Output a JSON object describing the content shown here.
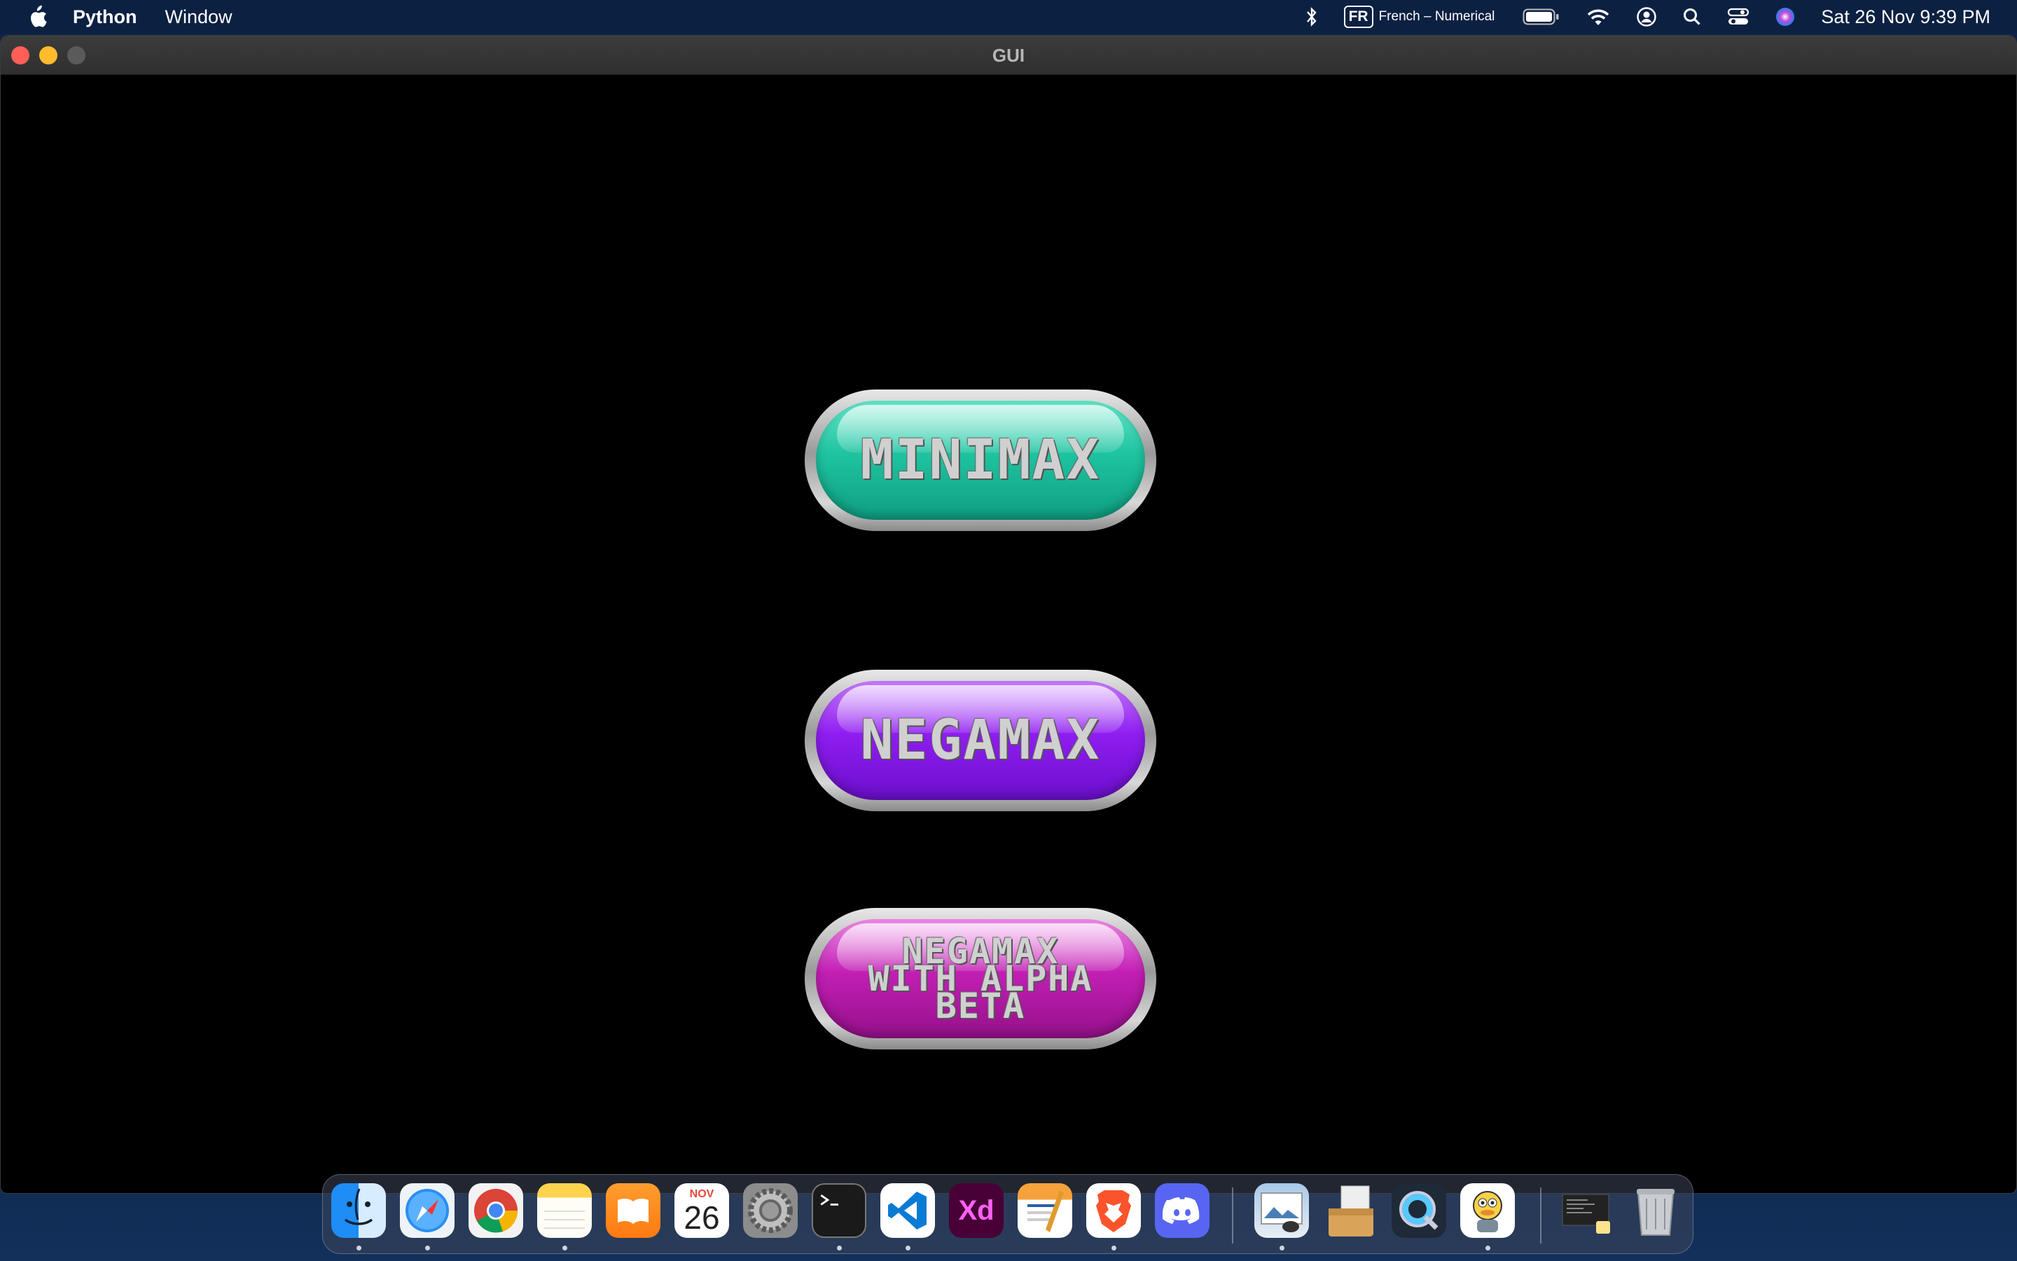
{
  "menubar": {
    "app_name": "Python",
    "menus": [
      "Window"
    ],
    "input_source_badge": "FR",
    "input_source_label": "French – Numerical",
    "datetime": "Sat 26 Nov  9:39 PM",
    "icons": [
      "apple-icon",
      "bluetooth-icon",
      "battery-icon",
      "wifi-icon",
      "user-icon",
      "search-icon",
      "control-center-icon",
      "siri-icon"
    ]
  },
  "window": {
    "title": "GUI"
  },
  "buttons": {
    "minimax": "MINIMAX",
    "negamax": "NEGAMAX",
    "alphabeta_lines": [
      "NEGAMAX",
      "WITH ALPHA",
      "BETA"
    ]
  },
  "dock": {
    "calendar_month": "NOV",
    "calendar_day": "26",
    "xd_label": "Xd",
    "apps": [
      "Finder",
      "Safari",
      "Chrome",
      "Notes",
      "Books",
      "Calendar",
      "System Preferences",
      "Terminal",
      "Visual Studio Code",
      "Adobe XD",
      "Pages",
      "Brave",
      "Discord",
      "Preview",
      "Files",
      "QuickTime Player",
      "Cyberduck",
      "Recent Document",
      "Trash"
    ]
  },
  "colors": {
    "minimax": "#1ec3a0",
    "negamax": "#8f1df0",
    "alphabeta": "#c21fb4",
    "menubar": "#0c2142"
  }
}
